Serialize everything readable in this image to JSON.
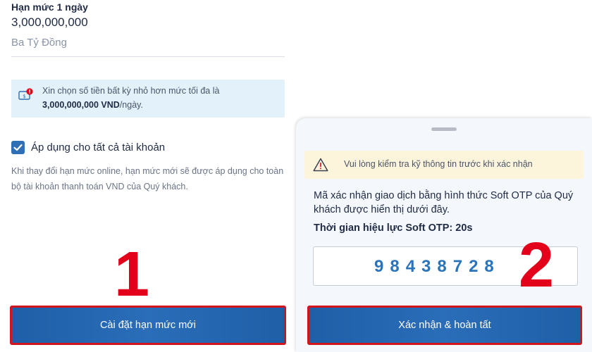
{
  "daily_limit": {
    "title": "Hạn mức 1 ngày",
    "value": "3,000,000,000",
    "in_words": "Ba Tỷ Đồng"
  },
  "info": {
    "line1": "Xin chọn số tiền bất kỳ nhỏ hơn mức tối đa là",
    "amount": "3,000,000,000 VND",
    "suffix": "/ngày.",
    "icon": "money-alert-icon"
  },
  "apply_all": {
    "label": "Áp dụng cho tất cả tài khoản",
    "checked": true,
    "description": "Khi thay đổi hạn mức online, hạn mức mới sẽ được áp dụng cho toàn bộ tài khoản thanh toán VND của Quý khách."
  },
  "step_markers": {
    "first": "1",
    "second": "2"
  },
  "buttons": {
    "set_limit": "Cài đặt hạn mức mới",
    "confirm": "Xác nhận & hoàn tất"
  },
  "otp_sheet": {
    "warning": "Vui lòng kiểm tra kỹ thông tin trước khi xác nhận",
    "description": "Mã xác nhận giao dịch bằng hình thức Soft OTP của Quý khách được hiển thị dưới đây.",
    "validity": "Thời gian hiệu lực Soft OTP:  20s",
    "code": "98438728"
  },
  "colors": {
    "primary": "#1f5fa8",
    "highlight_red": "#e3001b",
    "info_bg": "#e3f1fb",
    "warning_bg": "#fdf4dc"
  }
}
